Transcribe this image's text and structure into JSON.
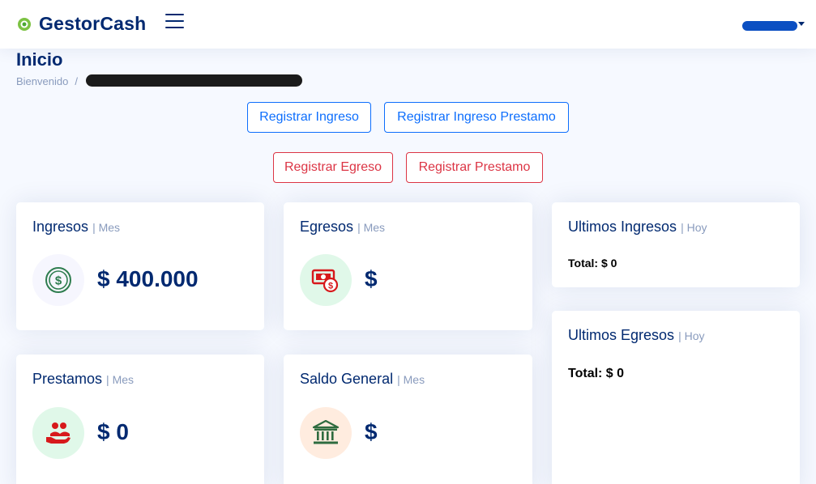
{
  "app": {
    "name": "GestorCash"
  },
  "page": {
    "title": "Inicio",
    "breadcrumb": {
      "home": "Bienvenido",
      "separator": "/"
    }
  },
  "actions": {
    "registrar_ingreso": "Registrar Ingreso",
    "registrar_ingreso_prestamo": "Registrar Ingreso Prestamo",
    "registrar_egreso": "Registrar Egreso",
    "registrar_prestamo": "Registrar Prestamo"
  },
  "cards": {
    "ingresos": {
      "title": "Ingresos",
      "period": "| Mes",
      "value": "$ 400.000",
      "icon": "dollar-coin-icon"
    },
    "egresos": {
      "title": "Egresos",
      "period": "| Mes",
      "value": "$",
      "icon": "cash-bill-icon"
    },
    "prestamos": {
      "title": "Prestamos",
      "period": "| Mes",
      "value": "$ 0",
      "icon": "hand-people-icon"
    },
    "saldo": {
      "title": "Saldo General",
      "period": "| Mes",
      "value": "$",
      "icon": "bank-icon"
    },
    "ultimos_ingresos": {
      "title": "Ultimos Ingresos",
      "period": "| Hoy",
      "total": "Total: $ 0"
    },
    "ultimos_egresos": {
      "title": "Ultimos Egresos",
      "period": "| Hoy",
      "total": "Total: $ 0"
    }
  },
  "colors": {
    "brand": "#012970",
    "muted": "#899bbd",
    "primary": "#0d6efd",
    "danger": "#dc3545",
    "ingresos_icon_bg": "#f6f6fe",
    "egresos_icon_bg": "#e0f8e9",
    "prestamos_icon_bg": "#e0f8e9",
    "saldo_icon_bg": "#ffecdf"
  }
}
